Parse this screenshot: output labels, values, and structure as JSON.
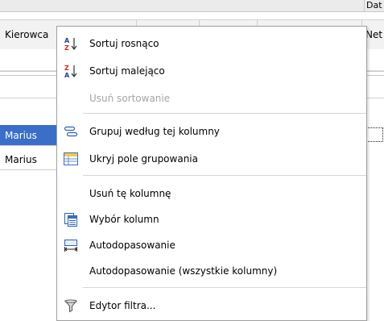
{
  "grid": {
    "top_header_fragment": "Dat",
    "columns": [
      "Kierowca",
      "",
      "",
      "",
      "Net"
    ],
    "rows": [
      {
        "name": "Marius",
        "selected": true
      },
      {
        "name": "Marius",
        "selected": false
      }
    ],
    "selection_color": "#3a6fc9"
  },
  "context_menu": {
    "items": [
      {
        "label": "Sortuj rosnąco",
        "icon": "sort-ascending-icon",
        "enabled": true
      },
      {
        "label": "Sortuj malejąco",
        "icon": "sort-descending-icon",
        "enabled": true
      },
      {
        "label": "Usuń sortowanie",
        "icon": null,
        "enabled": false
      },
      {
        "label": "Grupuj według tej kolumny",
        "icon": "group-by-icon",
        "enabled": true
      },
      {
        "label": "Ukryj pole grupowania",
        "icon": "group-panel-icon",
        "enabled": true
      },
      {
        "label": "Usuń tę kolumnę",
        "icon": null,
        "enabled": true
      },
      {
        "label": "Wybór kolumn",
        "icon": "column-chooser-icon",
        "enabled": true
      },
      {
        "label": "Autodopasowanie",
        "icon": "best-fit-icon",
        "enabled": true
      },
      {
        "label": "Autodopasowanie (wszystkie kolumny)",
        "icon": null,
        "enabled": true
      },
      {
        "label": "Edytor filtra...",
        "icon": "filter-icon",
        "enabled": true
      }
    ]
  }
}
